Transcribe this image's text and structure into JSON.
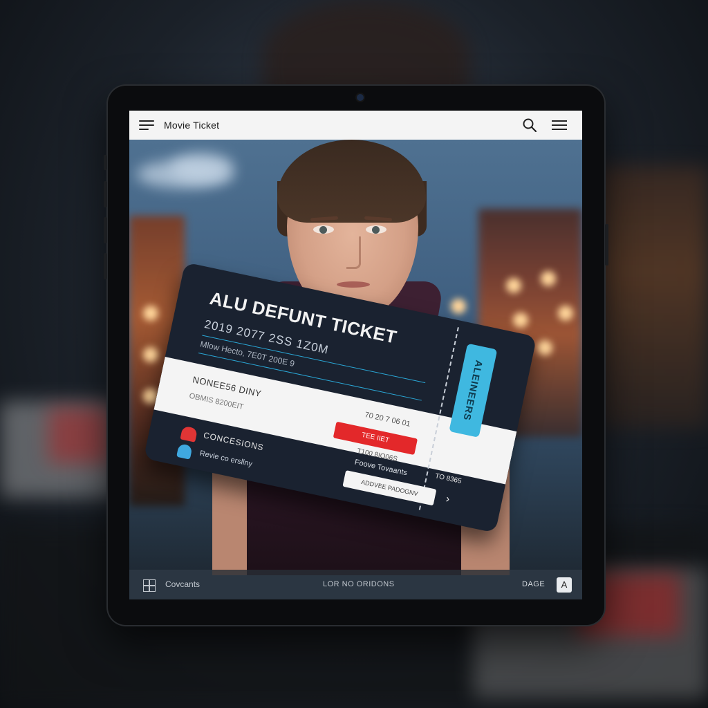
{
  "app": {
    "title": "Movie Ticket"
  },
  "ticket": {
    "title": "ALU DEFUNT TICKET",
    "date_line": "2019 2077 2SS 1Z0M",
    "sub_line": "Mlow Hecto, 7E0T 200E 9",
    "band_label_1": "NONEE56 DINY",
    "band_label_2": "OBMIS 8200EIT",
    "band_right_1": "70 20 7 06 01",
    "band_button": "TEE IIET",
    "band_right_2": "T100 8IO06S",
    "stub_text": "ALEINEERS",
    "stub_number": "TO 8365",
    "concessions_label": "CONCESIONS",
    "user_label": "Revie co ersllny",
    "footer_text": "Foove Tovaants",
    "footer_button": "ADDVEE PADOGNV",
    "chevron": "›"
  },
  "bottom_bar": {
    "left_label": "Covcants",
    "center_label": "LOR NO ORIDONS",
    "right_label": "DAGE",
    "right_icon_glyph": "A"
  },
  "colors": {
    "accent_red": "#e3282a",
    "accent_blue": "#3fb8e0",
    "ticket_bg": "#1a2230"
  }
}
